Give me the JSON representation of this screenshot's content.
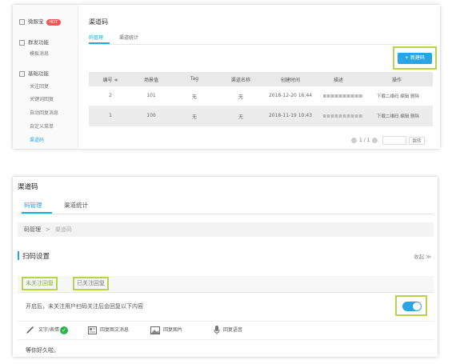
{
  "top": {
    "sidebar": {
      "brand": "微服宝",
      "hot_badge": "HOT",
      "sections": [
        {
          "title": "群发功能",
          "items": [
            "模板消息"
          ]
        },
        {
          "title": "基础功能",
          "items": [
            "关注回复",
            "关键词回复",
            "自动回复消息",
            "自定义菜单",
            "渠道码"
          ]
        }
      ]
    },
    "title": "渠道码",
    "tabs": [
      "码管理",
      "渠道统计"
    ],
    "new_button": "+ 新建码",
    "table": {
      "headers": [
        "编号 ≑",
        "场景值",
        "Tag",
        "渠道名称",
        "创建时间",
        "描述",
        "操作"
      ],
      "rows": [
        {
          "id": "2",
          "scene": "101",
          "tag": "无",
          "name": "无",
          "created": "2018-12-20 16:44"
        },
        {
          "id": "1",
          "scene": "100",
          "tag": "无",
          "name": "无",
          "created": "2018-11-19 10:43"
        }
      ],
      "actions": [
        "下载二维码",
        "编辑",
        "删除"
      ]
    },
    "pager": {
      "text": "1 / 1",
      "go": "跳转"
    }
  },
  "bottom": {
    "title": "渠道码",
    "tabs": [
      "码管理",
      "渠道统计"
    ],
    "breadcrumb": {
      "root": "码管理",
      "sep": ">",
      "current": "渠道码"
    },
    "section_title": "扫码设置",
    "collapse": "收起 ≫",
    "reply_tabs": [
      "未关注回复",
      "已关注回复"
    ],
    "toggle_text": "开启后，未关注用户扫码关注后会回复以下内容",
    "toggle_on": true,
    "types": [
      "文字/表情",
      "回复图文消息",
      "回复图片",
      "回复语音"
    ],
    "message": "等你好久啦。"
  },
  "colors": {
    "accent": "#2aa4e3",
    "highlight": "#b7d44a",
    "success": "#28b44b"
  }
}
